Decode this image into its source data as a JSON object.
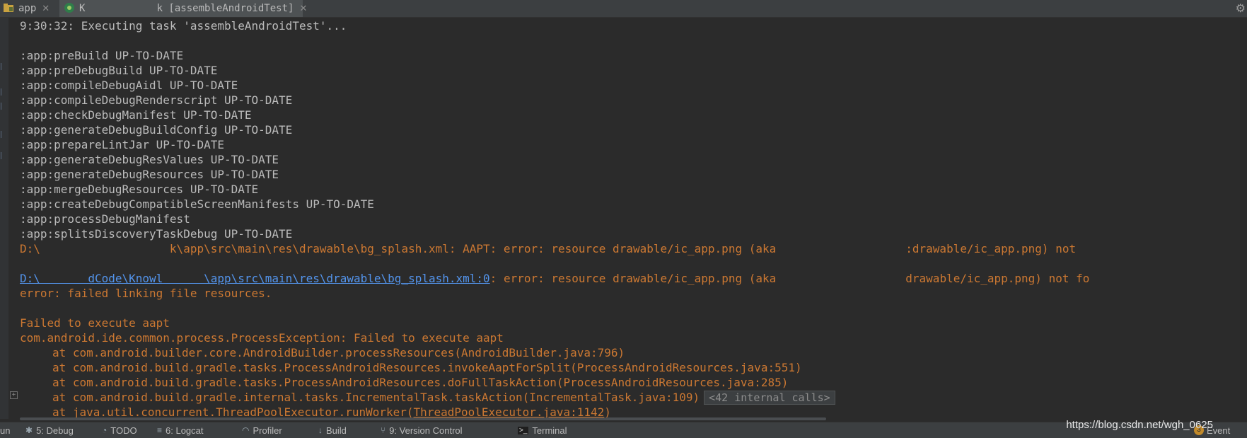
{
  "tabs": [
    {
      "label": "app",
      "active": false
    },
    {
      "label": "K            k [assembleAndroidTest]",
      "active": true
    }
  ],
  "console": {
    "lines": [
      {
        "text": "9:30:32: Executing task 'assembleAndroidTest'...",
        "type": "normal"
      },
      {
        "text": "",
        "type": "normal"
      },
      {
        "text": ":app:preBuild UP-TO-DATE",
        "type": "normal"
      },
      {
        "text": ":app:preDebugBuild UP-TO-DATE",
        "type": "normal"
      },
      {
        "text": ":app:compileDebugAidl UP-TO-DATE",
        "type": "normal"
      },
      {
        "text": ":app:compileDebugRenderscript UP-TO-DATE",
        "type": "normal"
      },
      {
        "text": ":app:checkDebugManifest UP-TO-DATE",
        "type": "normal"
      },
      {
        "text": ":app:generateDebugBuildConfig UP-TO-DATE",
        "type": "normal"
      },
      {
        "text": ":app:prepareLintJar UP-TO-DATE",
        "type": "normal"
      },
      {
        "text": ":app:generateDebugResValues UP-TO-DATE",
        "type": "normal"
      },
      {
        "text": ":app:generateDebugResources UP-TO-DATE",
        "type": "normal"
      },
      {
        "text": ":app:mergeDebugResources UP-TO-DATE",
        "type": "normal"
      },
      {
        "text": ":app:createDebugCompatibleScreenManifests UP-TO-DATE",
        "type": "normal"
      },
      {
        "text": ":app:processDebugManifest",
        "type": "normal"
      },
      {
        "text": ":app:splitsDiscoveryTaskDebug UP-TO-DATE",
        "type": "normal"
      }
    ],
    "error_line_1": "D:\\                   k\\app\\src\\main\\res\\drawable\\bg_splash.xml: AAPT: error: resource drawable/ic_app.png (aka                   :drawable/ic_app.png) not",
    "error_link": "D:\\       dCode\\Knowl      \\app\\src\\main\\res\\drawable\\bg_splash.xml:0",
    "error_line_2_rest": ": error: resource drawable/ic_app.png (aka                   drawable/ic_app.png) not fo",
    "error_line_3": "error: failed linking file resources.",
    "failed_execute": "Failed to execute aapt",
    "exception": "com.android.ide.common.process.ProcessException: Failed to execute aapt",
    "stack": [
      "at com.android.builder.core.AndroidBuilder.processResources(AndroidBuilder.java:796)",
      "at com.android.build.gradle.tasks.ProcessAndroidResources.invokeAaptForSplit(ProcessAndroidResources.java:551)",
      "at com.android.build.gradle.tasks.ProcessAndroidResources.doFullTaskAction(ProcessAndroidResources.java:285)",
      "at com.android.build.gradle.internal.tasks.IncrementalTask.taskAction(IncrementalTask.java:109)"
    ],
    "internal_calls": "<42 internal calls>",
    "last_stack_prefix": "at java.util.concurrent.ThreadPoolExecutor.runWorker(",
    "last_stack_link": "ThreadPoolExecutor.java:1142",
    "last_stack_suffix": ")"
  },
  "toolwindows": [
    {
      "label": "un",
      "icon": ""
    },
    {
      "label": "5: Debug",
      "icon": "bug-icon"
    },
    {
      "label": "TODO",
      "icon": "todo-icon"
    },
    {
      "label": "6: Logcat",
      "icon": "logcat-icon"
    },
    {
      "label": "Profiler",
      "icon": "profiler-icon"
    },
    {
      "label": "Build",
      "icon": "build-icon"
    },
    {
      "label": "9: Version Control",
      "icon": "vcs-icon"
    },
    {
      "label": "Terminal",
      "icon": "terminal-icon"
    }
  ],
  "event_log": {
    "count": "3",
    "label": "Event"
  },
  "watermark": "https://blog.csdn.net/wgh_0625",
  "colors": {
    "background": "#2b2b2b",
    "error": "#cc7832",
    "link": "#5394ec",
    "text": "#bbbbbb"
  }
}
